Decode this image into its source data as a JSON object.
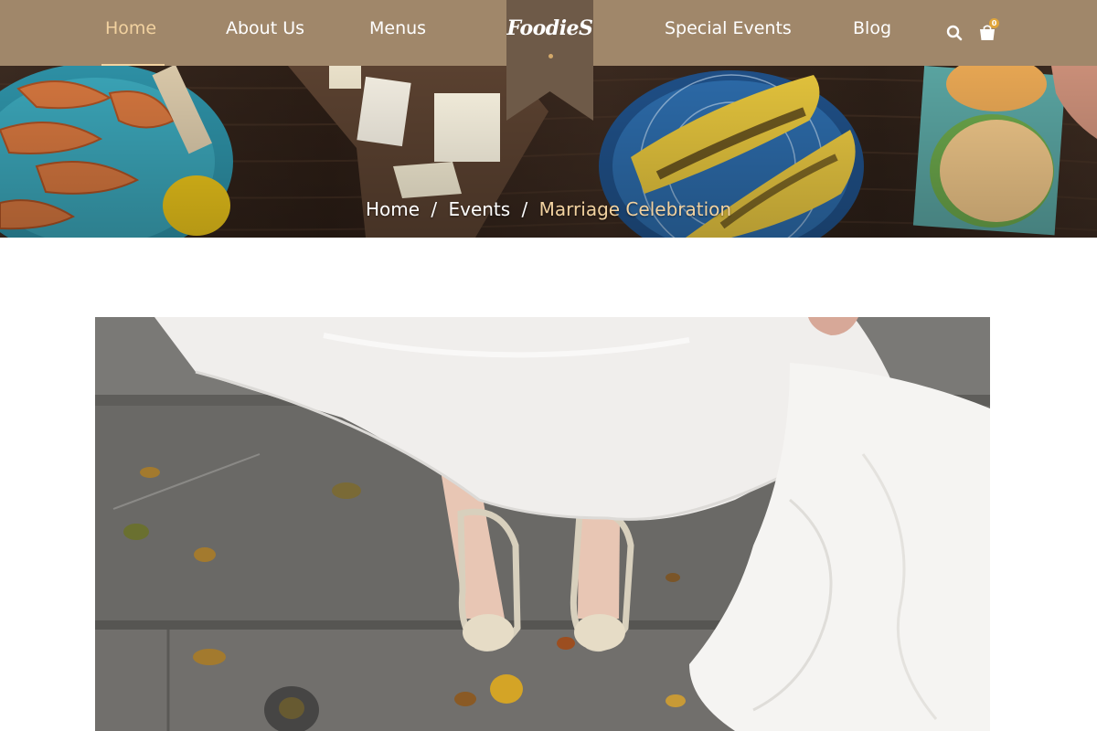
{
  "nav": {
    "items": [
      "Home",
      "About Us",
      "Menus",
      "Special Events",
      "Blog"
    ],
    "active": "Home",
    "logo": "FoodieS",
    "cart_count": "0",
    "icons": [
      "search-icon",
      "cart-icon"
    ]
  },
  "breadcrumb": {
    "home": "Home",
    "separator": "/",
    "section": "Events",
    "current": "Marriage Celebration"
  },
  "colors": {
    "nav_bg": "#a0876a",
    "logo_tab": "#6e5a48",
    "accent": "#f2d2a0"
  }
}
